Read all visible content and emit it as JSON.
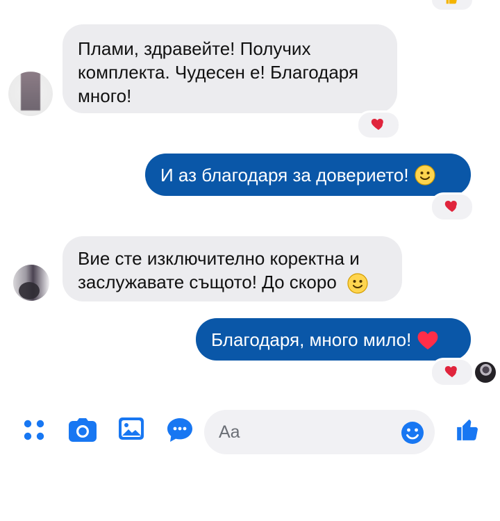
{
  "messages": [
    {
      "type": "incoming",
      "text": "Плами, здравейте! Получих комплекта. Чудесен е! Благодаря много!",
      "reaction": "heart"
    },
    {
      "type": "outgoing",
      "text": "И аз благодаря за доверието!",
      "emoji": "smile",
      "reaction": "heart"
    },
    {
      "type": "incoming",
      "text": "Вие сте изключително коректна и заслужавате същото! До скоро",
      "emoji": "smile"
    },
    {
      "type": "outgoing",
      "text": "Благодаря, много мило!",
      "emoji": "heart",
      "reaction": "heart"
    }
  ],
  "composer": {
    "placeholder": "Aa",
    "icons": [
      "apps-icon",
      "camera-icon",
      "gallery-icon",
      "chat-bubble-icon",
      "emoji-icon",
      "like-icon"
    ]
  },
  "colors": {
    "outgoing_bubble": "#0a57a8",
    "incoming_bubble": "#ececef",
    "accent": "#1877f2",
    "reaction_heart": "#e0243c"
  }
}
